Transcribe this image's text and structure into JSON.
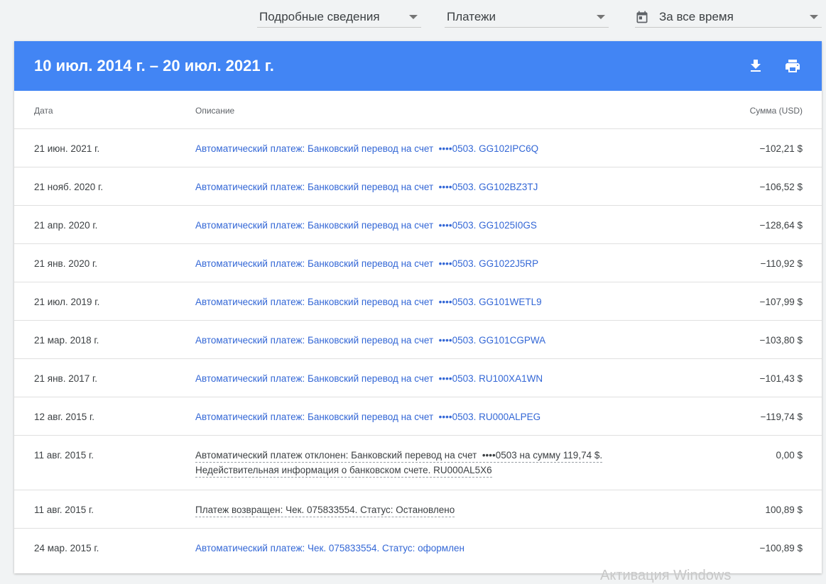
{
  "filters": {
    "details": "Подробные сведения",
    "type": "Платежи",
    "period": "За все время"
  },
  "report": {
    "title": "10 июл. 2014 г. – 20 июл. 2021 г.",
    "icons": {
      "download": "download-icon",
      "print": "print-icon"
    }
  },
  "table": {
    "headers": {
      "date": "Дата",
      "description": "Описание",
      "amount": "Сумма (USD)"
    },
    "rows": [
      {
        "date": "21 июн. 2021 г.",
        "description": "Автоматический платеж: Банковский перевод на счет  ••••0503. GG102IPC6Q",
        "amount": "−102,21 $"
      },
      {
        "date": "21 нояб. 2020 г.",
        "description": "Автоматический платеж: Банковский перевод на счет  ••••0503. GG102BZ3TJ",
        "amount": "−106,52 $"
      },
      {
        "date": "21 апр. 2020 г.",
        "description": "Автоматический платеж: Банковский перевод на счет  ••••0503. GG1025I0GS",
        "amount": "−128,64 $"
      },
      {
        "date": "21 янв. 2020 г.",
        "description": "Автоматический платеж: Банковский перевод на счет  ••••0503. GG1022J5RP",
        "amount": "−110,92 $"
      },
      {
        "date": "21 июл. 2019 г.",
        "description": "Автоматический платеж: Банковский перевод на счет  ••••0503. GG101WETL9",
        "amount": "−107,99 $"
      },
      {
        "date": "21 мар. 2018 г.",
        "description": "Автоматический платеж: Банковский перевод на счет  ••••0503. GG101CGPWA",
        "amount": "−103,80 $"
      },
      {
        "date": "21 янв. 2017 г.",
        "description": "Автоматический платеж: Банковский перевод на счет  ••••0503. RU100XA1WN",
        "amount": "−101,43 $"
      },
      {
        "date": "12 авг. 2015 г.",
        "description": "Автоматический платеж: Банковский перевод на счет  ••••0503. RU000ALPEG",
        "amount": "−119,74 $"
      },
      {
        "date": "11 авг. 2015 г.",
        "description_line1": "Автоматический платеж отклонен: Банковский перевод на счет  ••••0503 на сумму 119,74 $.",
        "description_line2": "Недействительная информация о банковском счете. RU000AL5X6",
        "amount": "0,00 $"
      },
      {
        "date": "11 авг. 2015 г.",
        "description": "Платеж возвращен: Чек. 075833554. Статус: Остановлено",
        "amount": "100,89 $"
      },
      {
        "date": "24 мар. 2015 г.",
        "description": "Автоматический платеж: Чек. 075833554. Статус: оформлен",
        "amount": "−100,89 $"
      }
    ]
  },
  "watermark": "Активация Windows",
  "colors": {
    "header_bg": "#4285f4",
    "link": "#3367d6",
    "text": "#3c4043"
  }
}
